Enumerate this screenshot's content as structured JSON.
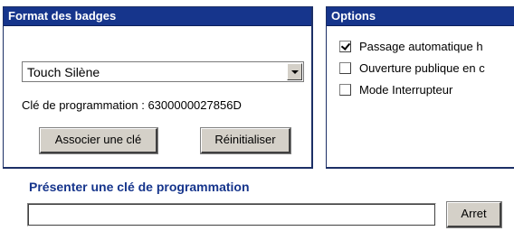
{
  "format_panel": {
    "title": "Format des badges",
    "select_value": "Touch Silène",
    "programming_key_text": "Clé de programmation : 6300000027856D",
    "associate_label": "Associer une clé",
    "reset_label": "Réinitialiser"
  },
  "options_panel": {
    "title": "Options",
    "items": [
      {
        "label": "Passage automatique h",
        "checked": true
      },
      {
        "label": "Ouverture publique en c",
        "checked": false
      },
      {
        "label": "Mode Interrupteur",
        "checked": false
      }
    ]
  },
  "present_key": {
    "title": "Présenter une clé de programmation",
    "input_value": "",
    "stop_label": "Arret"
  }
}
